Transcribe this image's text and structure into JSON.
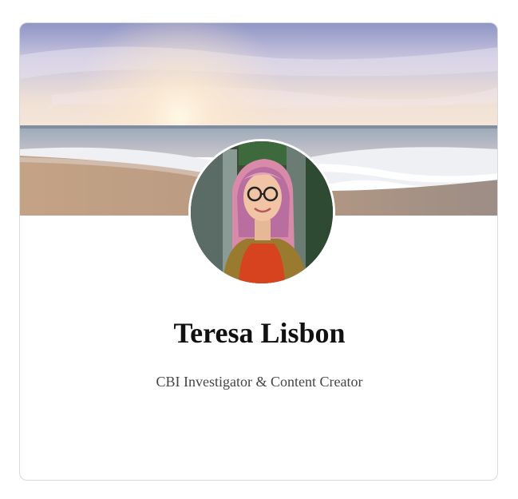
{
  "profile": {
    "name": "Teresa Lisbon",
    "title": "CBI Investigator & Content Creator"
  },
  "colors": {
    "card_border": "#d9d9d9",
    "name_text": "#111111",
    "subtitle_text": "#444444"
  }
}
